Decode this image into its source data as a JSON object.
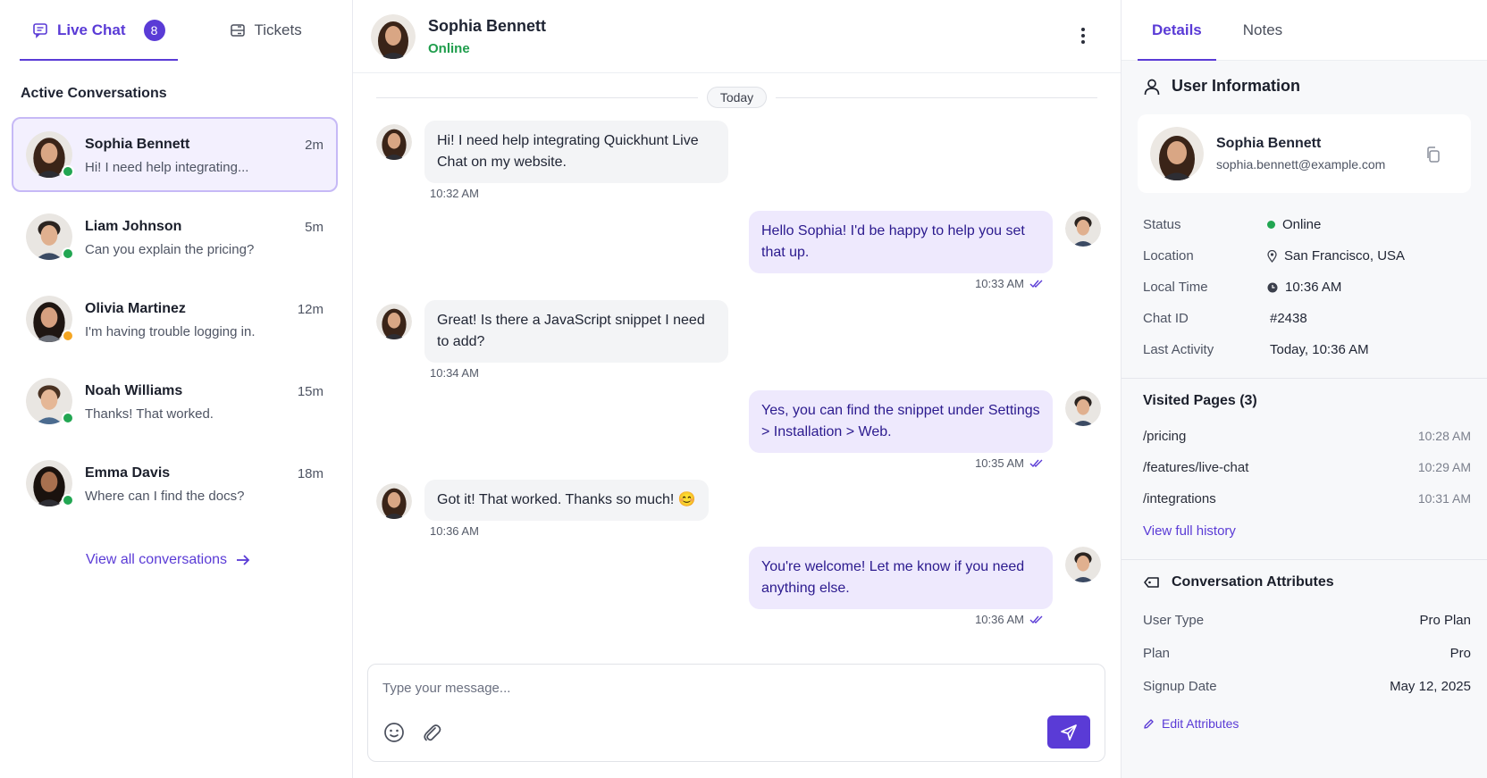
{
  "left": {
    "tabs": [
      {
        "label": "Live Chat",
        "badge": "8",
        "icon": "chat-icon"
      },
      {
        "label": "Tickets",
        "icon": "ticket-icon"
      }
    ],
    "section_title": "Active Conversations",
    "conversations": [
      {
        "name": "Sophia Bennett",
        "time": "2m",
        "preview": "Hi! I need help integrating...",
        "status": "online",
        "skin": "#d9a684",
        "hair": "#3a2418"
      },
      {
        "name": "Liam Johnson",
        "time": "5m",
        "preview": "Can you explain the pricing?",
        "status": "online",
        "skin": "#e0b08f",
        "hair": "#2b2420"
      },
      {
        "name": "Olivia Martinez",
        "time": "12m",
        "preview": "I'm having trouble logging in.",
        "status": "away",
        "skin": "#d6a080",
        "hair": "#1f1612"
      },
      {
        "name": "Noah Williams",
        "time": "15m",
        "preview": "Thanks! That worked.",
        "status": "online",
        "skin": "#e5b796",
        "hair": "#4a3222"
      },
      {
        "name": "Emma Davis",
        "time": "18m",
        "preview": "Where can I find the docs?",
        "status": "online",
        "skin": "#a8704f",
        "hair": "#1a120e"
      }
    ],
    "view_all": "View all conversations"
  },
  "chat": {
    "header": {
      "name": "Sophia Bennett",
      "status": "Online"
    },
    "date_divider": "Today",
    "messages": [
      {
        "from": "user",
        "text": "Hi! I need help integrating Quickhunt Live Chat on my website.",
        "time": "10:32 AM"
      },
      {
        "from": "agent",
        "text": "Hello Sophia! I'd be happy to help you set that up.",
        "time": "10:33 AM"
      },
      {
        "from": "user",
        "text": "Great! Is there a JavaScript snippet I need to add?",
        "time": "10:34 AM"
      },
      {
        "from": "agent",
        "text": "Yes, you can find the snippet under Settings > Installation > Web.",
        "time": "10:35 AM"
      },
      {
        "from": "user",
        "text": "Got it! That worked. Thanks so much! 😊",
        "time": "10:36 AM"
      },
      {
        "from": "agent",
        "text": "You're welcome! Let me know if you need anything else.",
        "time": "10:36 AM"
      }
    ],
    "composer_placeholder": "Type your message..."
  },
  "details": {
    "tabs": [
      "Details",
      "Notes"
    ],
    "user_info_title": "User Information",
    "user": {
      "name": "Sophia Bennett",
      "email": "sophia.bennett@example.com"
    },
    "fields": [
      {
        "key": "Status",
        "value": "Online"
      },
      {
        "key": "Location",
        "value": "San Francisco, USA"
      },
      {
        "key": "Local Time",
        "value": "10:36 AM"
      },
      {
        "key": "Chat ID",
        "value": "#2438"
      },
      {
        "key": "Last Activity",
        "value": "Today, 10:36 AM"
      }
    ],
    "visited_title": "Visited Pages (3)",
    "visited": [
      {
        "path": "/pricing",
        "time": "10:28 AM"
      },
      {
        "path": "/features/live-chat",
        "time": "10:29 AM"
      },
      {
        "path": "/integrations",
        "time": "10:31 AM"
      }
    ],
    "view_history": "View full history",
    "attributes_title": "Conversation Attributes",
    "attributes": [
      {
        "key": "User Type",
        "value": "Pro Plan"
      },
      {
        "key": "Plan",
        "value": "Pro"
      },
      {
        "key": "Signup Date",
        "value": "May 12, 2025"
      }
    ],
    "edit_attributes": "Edit Attributes"
  },
  "colors": {
    "accent": "#5a3bd6",
    "online": "#22a652",
    "away": "#f5a623"
  }
}
